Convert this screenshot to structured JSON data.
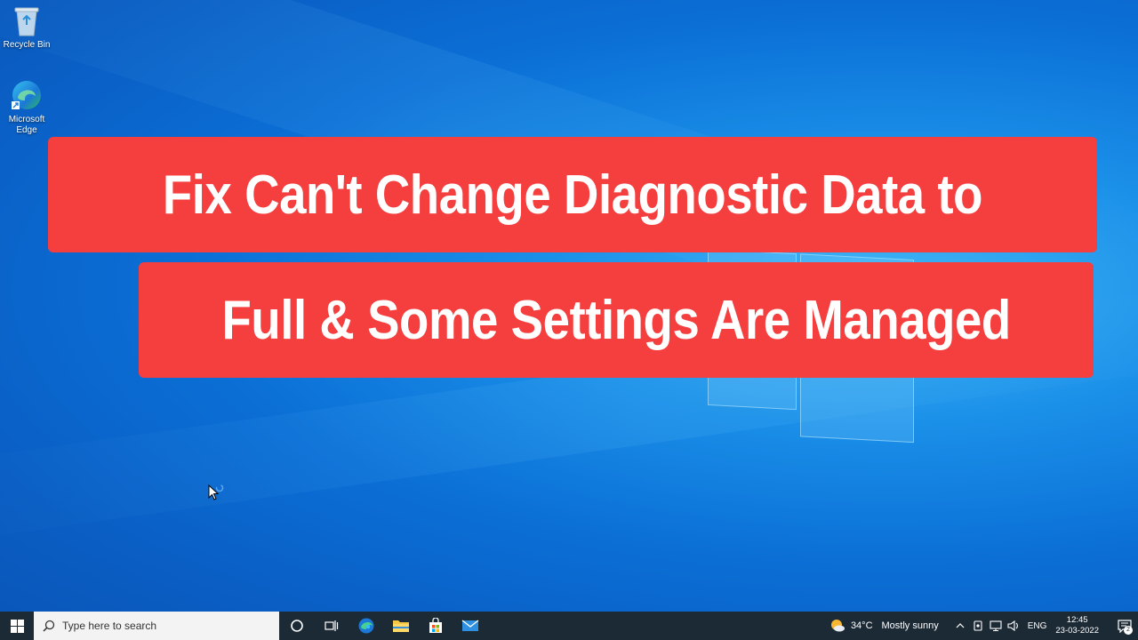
{
  "desktop": {
    "icons": [
      {
        "label": "Recycle Bin",
        "icon": "recycle-bin-icon"
      },
      {
        "label": "Microsoft Edge",
        "icon": "edge-icon"
      }
    ]
  },
  "title": {
    "line1": "Fix Can't Change Diagnostic Data to",
    "line2": "Full & Some Settings Are Managed",
    "bg_color": "#f53e3e"
  },
  "taskbar": {
    "search_placeholder": "Type here to search",
    "pinned": [
      "cortana-icon",
      "task-view-icon",
      "edge-icon",
      "file-explorer-icon",
      "store-icon",
      "mail-icon"
    ],
    "weather": {
      "temp": "34°C",
      "condition": "Mostly sunny"
    },
    "language": "ENG",
    "time": "12:45",
    "date": "23-03-2022",
    "notification_count": "2"
  }
}
